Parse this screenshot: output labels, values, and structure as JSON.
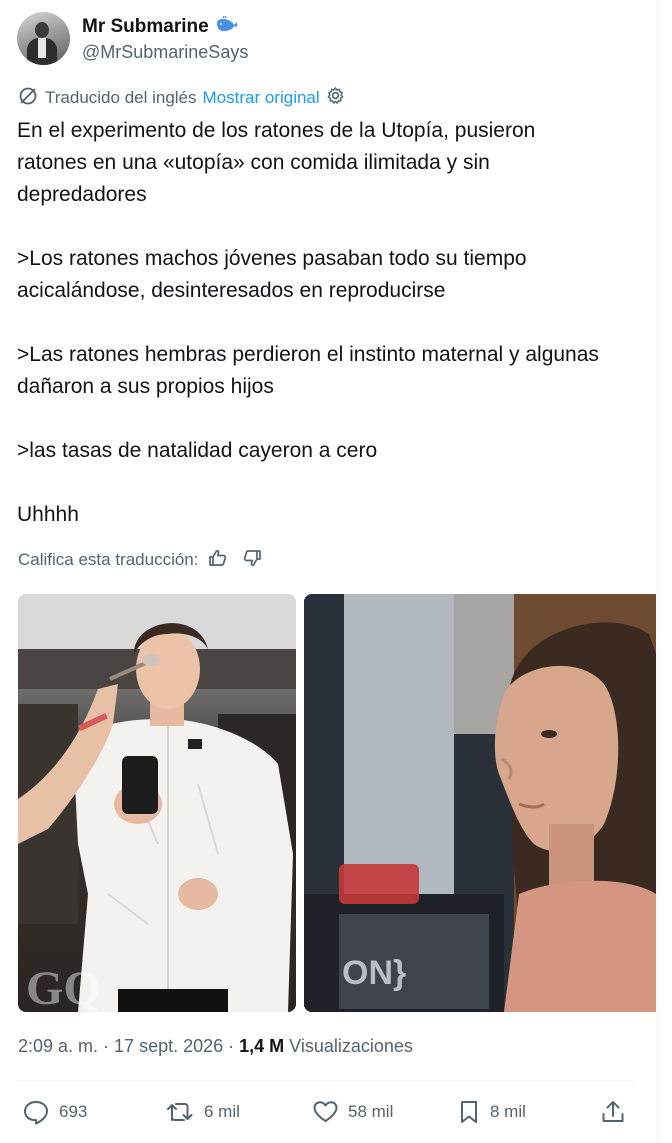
{
  "tweet": {
    "author": {
      "display_name": "Mr Submarine",
      "handle": "@MrSubmarineSays",
      "badge_icon": "whale-icon"
    },
    "translation": {
      "label": "Traducido del inglés",
      "show_original": "Mostrar original"
    },
    "text": {
      "p1": "En el experimento de los ratones de la Utopía, pusieron ratones en una «utopía» con comida ilimitada y sin depredadores",
      "p2": ">Los ratones machos jóvenes pasaban todo su tiempo acicalándose, desinteresados en reproducirse",
      "p3": ">Las ratones hembras perdieron el instinto maternal y algunas dañaron a sus propios hijos",
      "p4": ">las tasas de natalidad cayeron a cero",
      "p5": "Uhhhh"
    },
    "rate": {
      "label": "Califica esta traducción:"
    },
    "media": {
      "watermark": "GQ",
      "sign_text": "ON}"
    },
    "meta": {
      "time": "2:09 a. m.",
      "date": "17 sept. 2026",
      "views_count": "1,4 M",
      "views_label": "Visualizaciones"
    },
    "actions": {
      "replies": "693",
      "reposts": "6 mil",
      "likes": "58 mil",
      "bookmarks": "8 mil"
    }
  },
  "colors": {
    "text": "#0f1419",
    "secondary": "#536471",
    "link": "#1d9bf0",
    "whale": "#4a90e2",
    "divider": "#eff3f4"
  }
}
